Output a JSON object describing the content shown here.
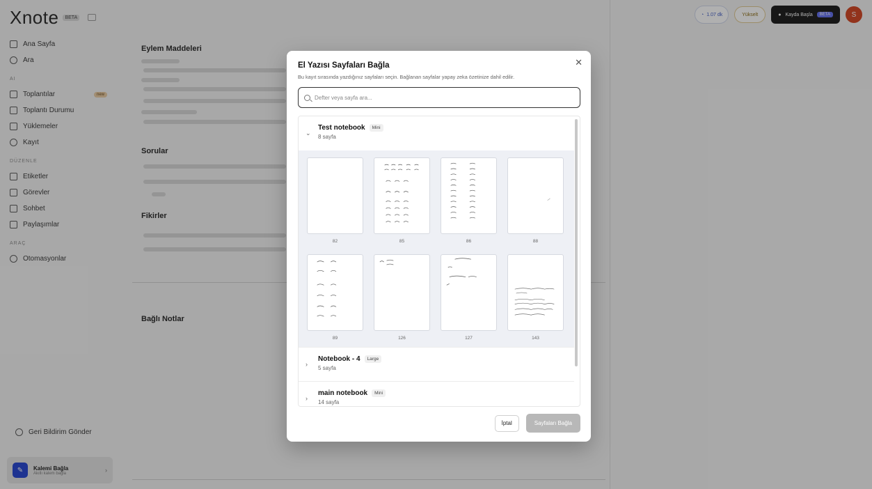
{
  "modal": {
    "title": "El Yazısı Sayfaları Bağla",
    "description": "Bu kayıt sırasında yazdığınız sayfaları seçin. Bağlanan sayfalar yapay zeka özetinize dahil edilir.",
    "search_placeholder": "Defter veya sayfa ara...",
    "cancel_label": "İptal",
    "confirm_label": "Sayfaları Bağla"
  },
  "notebooks": [
    {
      "name": "Test notebook",
      "size": "Mini",
      "page_count": "8 sayfa",
      "expanded": true,
      "pages": [
        {
          "number": "82"
        },
        {
          "number": "85"
        },
        {
          "number": "86"
        },
        {
          "number": "88"
        },
        {
          "number": "89"
        },
        {
          "number": "126"
        },
        {
          "number": "127"
        },
        {
          "number": "143"
        }
      ]
    },
    {
      "name": "Notebook - 4",
      "size": "Large",
      "page_count": "5 sayfa",
      "expanded": false
    },
    {
      "name": "main notebook",
      "size": "Mini",
      "page_count": "14 sayfa",
      "expanded": false
    }
  ],
  "background": {
    "logo": "Xnote",
    "logo_badge": "BETA",
    "nav": [
      {
        "label": "Ana Sayfa",
        "icon": "home-icon"
      },
      {
        "label": "Ara",
        "icon": "search-icon"
      }
    ],
    "nav_section_1": "AI",
    "nav2": [
      {
        "label": "Toplantılar",
        "icon": "calendar-icon",
        "pill": "new"
      },
      {
        "label": "Toplantı Durumu",
        "icon": "calendar-icon"
      },
      {
        "label": "Yüklemeler",
        "icon": "upload-icon"
      },
      {
        "label": "Kayıt",
        "icon": "record-icon"
      }
    ],
    "nav_section_2": "DÜZENLE",
    "nav3": [
      {
        "label": "Etiketler",
        "icon": "tag-icon"
      },
      {
        "label": "Görevler",
        "icon": "task-icon"
      },
      {
        "label": "Sohbet",
        "icon": "chat-icon"
      },
      {
        "label": "Paylaşımlar",
        "icon": "share-icon"
      }
    ],
    "nav_section_3": "ARAÇ",
    "nav4": [
      {
        "label": "Otomasyonlar",
        "icon": "automation-icon"
      }
    ],
    "guides": "Geri Bildirim Gönder",
    "pen_title": "Kalemi Bağla",
    "pen_sub": "Akıllı kalem bağla",
    "top_stat": "1.07 dk",
    "upgrade": "Yükselt",
    "record_btn": "Kayda Başla",
    "record_beta": "BETA",
    "avatar_initial": "S",
    "sections": {
      "action_items": "Eylem Maddeleri",
      "questions": "Sorular",
      "ideas": "Fikirler",
      "linked_notes": "Bağlı Notlar"
    }
  }
}
